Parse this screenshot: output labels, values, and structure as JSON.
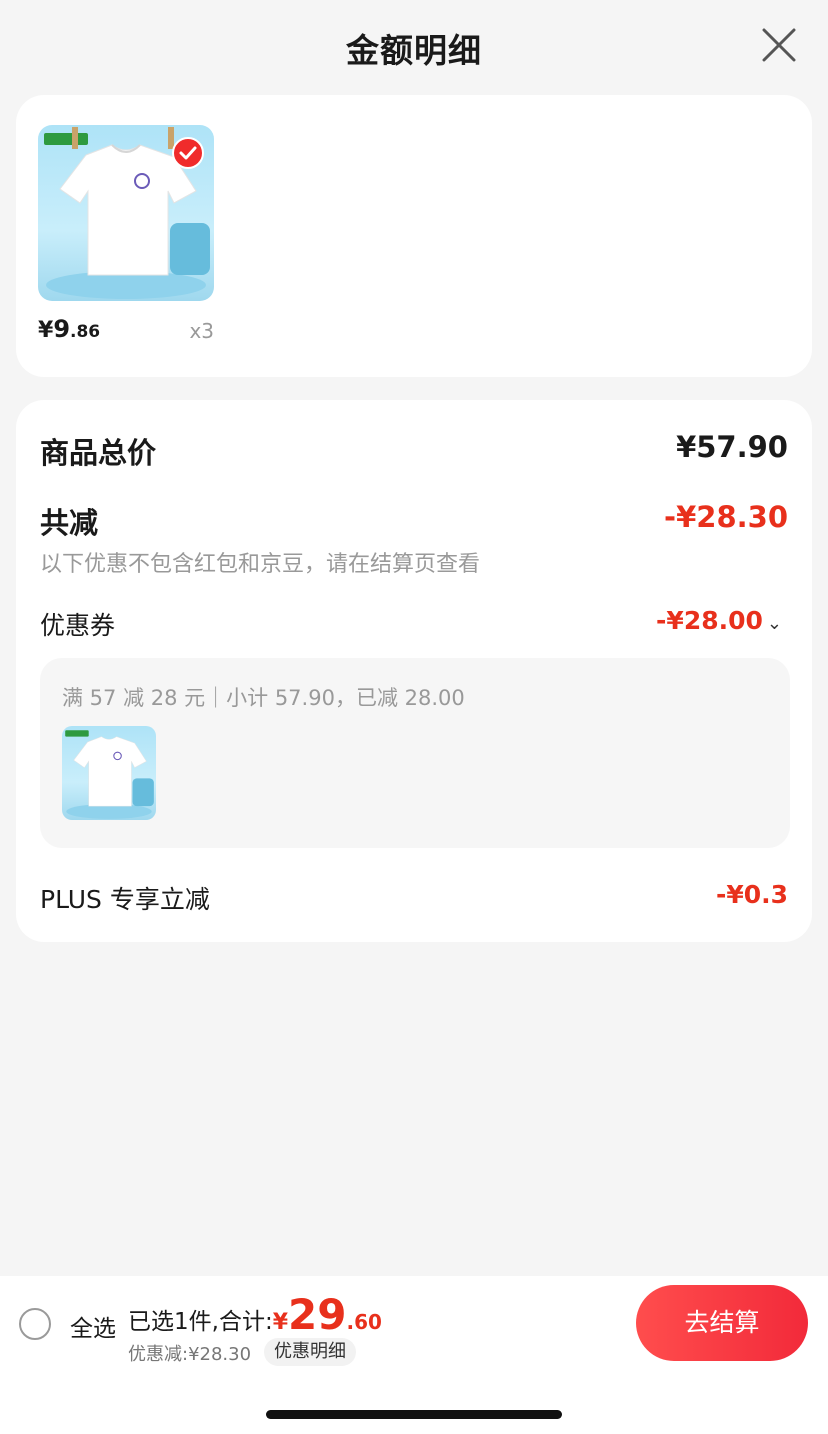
{
  "header": {
    "title": "金额明细",
    "close_icon": "close-icon"
  },
  "product": {
    "price_currency": "¥",
    "price_int": "9",
    "price_dec": ".86",
    "quantity": "x3",
    "selected": true
  },
  "detail": {
    "total_label": "商品总价",
    "total_value": "¥57.90",
    "discount_label": "共减",
    "discount_value": "-¥28.30",
    "discount_hint": "以下优惠不包含红包和京豆，请在结算页查看",
    "coupon_label": "优惠券",
    "coupon_value": "-¥28.00",
    "coupon_rule": "满 57 减 28 元｜小计 57.90，已减 28.00",
    "plus_label": "PLUS 专享立减",
    "plus_value": "-¥0.3"
  },
  "bottom_bar": {
    "select_all_label": "全选",
    "summary_label": "已选1件,合计:",
    "total_currency": "¥",
    "total_int": "29",
    "total_dec": ".60",
    "discount_line": "优惠减:¥28.30",
    "detail_link": "优惠明细",
    "checkout_label": "去结算"
  },
  "colors": {
    "accent_red": "#e8301c",
    "button_red": "#f22a3a",
    "background": "#f5f5f5"
  }
}
